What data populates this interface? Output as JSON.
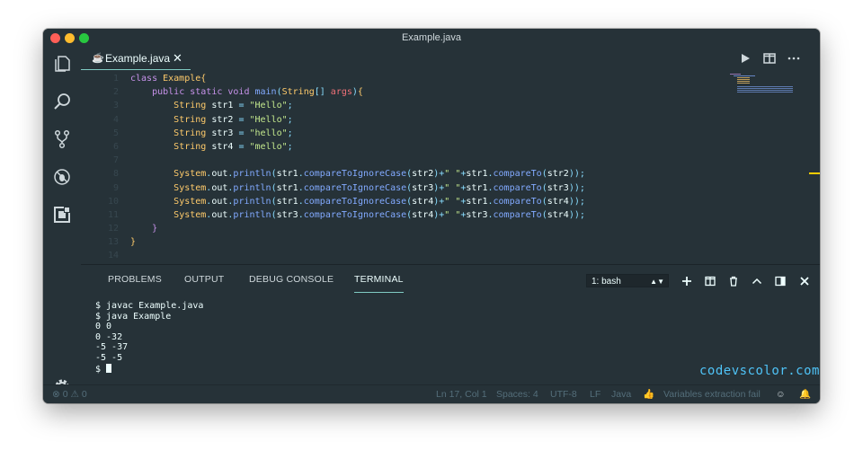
{
  "window": {
    "title": "Example.java"
  },
  "editor": {
    "tab": {
      "label": "Example.java"
    },
    "lines": [
      {
        "n": "1",
        "t": [
          [
            "kw",
            "class "
          ],
          [
            "cls",
            "Example"
          ],
          [
            "bk",
            "{"
          ]
        ]
      },
      {
        "n": "2",
        "t": [
          [
            "",
            "    "
          ],
          [
            "kw",
            "public static void "
          ],
          [
            "fn",
            "main"
          ],
          [
            "op",
            "("
          ],
          [
            "cls",
            "String"
          ],
          [
            "op",
            "[] "
          ],
          [
            "par",
            "args"
          ],
          [
            "op",
            ")"
          ],
          [
            "bk",
            "{"
          ]
        ]
      },
      {
        "n": "3",
        "t": [
          [
            "",
            "        "
          ],
          [
            "cls",
            "String "
          ],
          [
            "",
            "str1 "
          ],
          [
            "op",
            "= "
          ],
          [
            "str",
            "\"Hello\""
          ],
          [
            "op",
            ";"
          ]
        ]
      },
      {
        "n": "4",
        "t": [
          [
            "",
            "        "
          ],
          [
            "cls",
            "String "
          ],
          [
            "",
            "str2 "
          ],
          [
            "op",
            "= "
          ],
          [
            "str",
            "\"Hello\""
          ],
          [
            "op",
            ";"
          ]
        ]
      },
      {
        "n": "5",
        "t": [
          [
            "",
            "        "
          ],
          [
            "cls",
            "String "
          ],
          [
            "",
            "str3 "
          ],
          [
            "op",
            "= "
          ],
          [
            "str",
            "\"hello\""
          ],
          [
            "op",
            ";"
          ]
        ]
      },
      {
        "n": "6",
        "t": [
          [
            "",
            "        "
          ],
          [
            "cls",
            "String "
          ],
          [
            "",
            "str4 "
          ],
          [
            "op",
            "= "
          ],
          [
            "str",
            "\"mello\""
          ],
          [
            "op",
            ";"
          ]
        ]
      },
      {
        "n": "7",
        "t": []
      },
      {
        "n": "8",
        "t": [
          [
            "",
            "        "
          ],
          [
            "cls",
            "System"
          ],
          [
            "op",
            "."
          ],
          [
            "",
            "out"
          ],
          [
            "op",
            "."
          ],
          [
            "fn",
            "println"
          ],
          [
            "op",
            "("
          ],
          [
            "",
            "str1"
          ],
          [
            "op",
            "."
          ],
          [
            "fn",
            "compareToIgnoreCase"
          ],
          [
            "op",
            "("
          ],
          [
            "",
            "str2"
          ],
          [
            "op",
            ")+"
          ],
          [
            "str",
            "\" \""
          ],
          [
            "op",
            "+"
          ],
          [
            "",
            "str1"
          ],
          [
            "op",
            "."
          ],
          [
            "fn",
            "compareTo"
          ],
          [
            "op",
            "("
          ],
          [
            "",
            "str2"
          ],
          [
            "op",
            "));"
          ]
        ]
      },
      {
        "n": "9",
        "t": [
          [
            "",
            "        "
          ],
          [
            "cls",
            "System"
          ],
          [
            "op",
            "."
          ],
          [
            "",
            "out"
          ],
          [
            "op",
            "."
          ],
          [
            "fn",
            "println"
          ],
          [
            "op",
            "("
          ],
          [
            "",
            "str1"
          ],
          [
            "op",
            "."
          ],
          [
            "fn",
            "compareToIgnoreCase"
          ],
          [
            "op",
            "("
          ],
          [
            "",
            "str3"
          ],
          [
            "op",
            ")+"
          ],
          [
            "str",
            "\" \""
          ],
          [
            "op",
            "+"
          ],
          [
            "",
            "str1"
          ],
          [
            "op",
            "."
          ],
          [
            "fn",
            "compareTo"
          ],
          [
            "op",
            "("
          ],
          [
            "",
            "str3"
          ],
          [
            "op",
            "));"
          ]
        ]
      },
      {
        "n": "10",
        "t": [
          [
            "",
            "        "
          ],
          [
            "cls",
            "System"
          ],
          [
            "op",
            "."
          ],
          [
            "",
            "out"
          ],
          [
            "op",
            "."
          ],
          [
            "fn",
            "println"
          ],
          [
            "op",
            "("
          ],
          [
            "",
            "str1"
          ],
          [
            "op",
            "."
          ],
          [
            "fn",
            "compareToIgnoreCase"
          ],
          [
            "op",
            "("
          ],
          [
            "",
            "str4"
          ],
          [
            "op",
            ")+"
          ],
          [
            "str",
            "\" \""
          ],
          [
            "op",
            "+"
          ],
          [
            "",
            "str1"
          ],
          [
            "op",
            "."
          ],
          [
            "fn",
            "compareTo"
          ],
          [
            "op",
            "("
          ],
          [
            "",
            "str4"
          ],
          [
            "op",
            "));"
          ]
        ]
      },
      {
        "n": "11",
        "t": [
          [
            "",
            "        "
          ],
          [
            "cls",
            "System"
          ],
          [
            "op",
            "."
          ],
          [
            "",
            "out"
          ],
          [
            "op",
            "."
          ],
          [
            "fn",
            "println"
          ],
          [
            "op",
            "("
          ],
          [
            "",
            "str3"
          ],
          [
            "op",
            "."
          ],
          [
            "fn",
            "compareToIgnoreCase"
          ],
          [
            "op",
            "("
          ],
          [
            "",
            "str4"
          ],
          [
            "op",
            ")+"
          ],
          [
            "str",
            "\" \""
          ],
          [
            "op",
            "+"
          ],
          [
            "",
            "str3"
          ],
          [
            "op",
            "."
          ],
          [
            "fn",
            "compareTo"
          ],
          [
            "op",
            "("
          ],
          [
            "",
            "str4"
          ],
          [
            "op",
            "));"
          ]
        ]
      },
      {
        "n": "12",
        "t": [
          [
            "",
            "    "
          ],
          [
            "kw",
            "}"
          ]
        ]
      },
      {
        "n": "13",
        "t": [
          [
            "bk",
            "}"
          ]
        ]
      },
      {
        "n": "14",
        "t": []
      }
    ]
  },
  "panel": {
    "tabs": [
      "PROBLEMS",
      "OUTPUT",
      "DEBUG CONSOLE",
      "TERMINAL"
    ],
    "active_tab": "TERMINAL",
    "terminal_select": "1: bash",
    "terminal_lines": [
      "$ javac Example.java",
      "$ java Example",
      "0 0",
      "0 -32",
      "-5 -37",
      "-5 -5",
      "$ "
    ]
  },
  "watermark": "codevscolor.com",
  "statusbar": {
    "errors": "0",
    "warnings": "0",
    "position": "Ln 17, Col 1",
    "spaces": "Spaces: 4",
    "encoding": "UTF-8",
    "eol": "LF",
    "language": "Java",
    "message": "Variables extraction fail"
  },
  "colors": {
    "background": "#263238",
    "accent": "#80cbc4",
    "keyword": "#c792ea",
    "class": "#ffcb6b",
    "function": "#82aaff",
    "string": "#c3e88d",
    "operator": "#89ddff",
    "watermark": "#4fc3f7"
  },
  "icons": [
    "explorer-icon",
    "search-icon",
    "source-control-icon",
    "debug-icon",
    "extensions-icon",
    "gear-icon",
    "run-icon",
    "split-editor-icon",
    "more-icon",
    "add-terminal-icon",
    "split-terminal-icon",
    "trash-icon",
    "chevron-up-icon",
    "maximize-panel-icon",
    "close-icon",
    "feedback-icon",
    "bell-icon"
  ]
}
